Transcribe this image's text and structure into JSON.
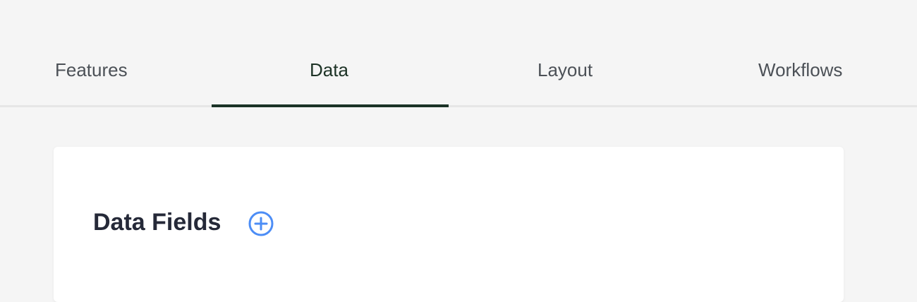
{
  "tabs": {
    "features": "Features",
    "data": "Data",
    "layout": "Layout",
    "workflows": "Workflows",
    "active": "Data"
  },
  "section": {
    "title": "Data Fields",
    "add_icon": "plus-circle-icon"
  },
  "colors": {
    "background": "#f5f5f5",
    "active_tab": "#1b3326",
    "tab_text": "#4c5157",
    "title": "#252938",
    "accent": "#4c8df6",
    "card": "#ffffff"
  }
}
